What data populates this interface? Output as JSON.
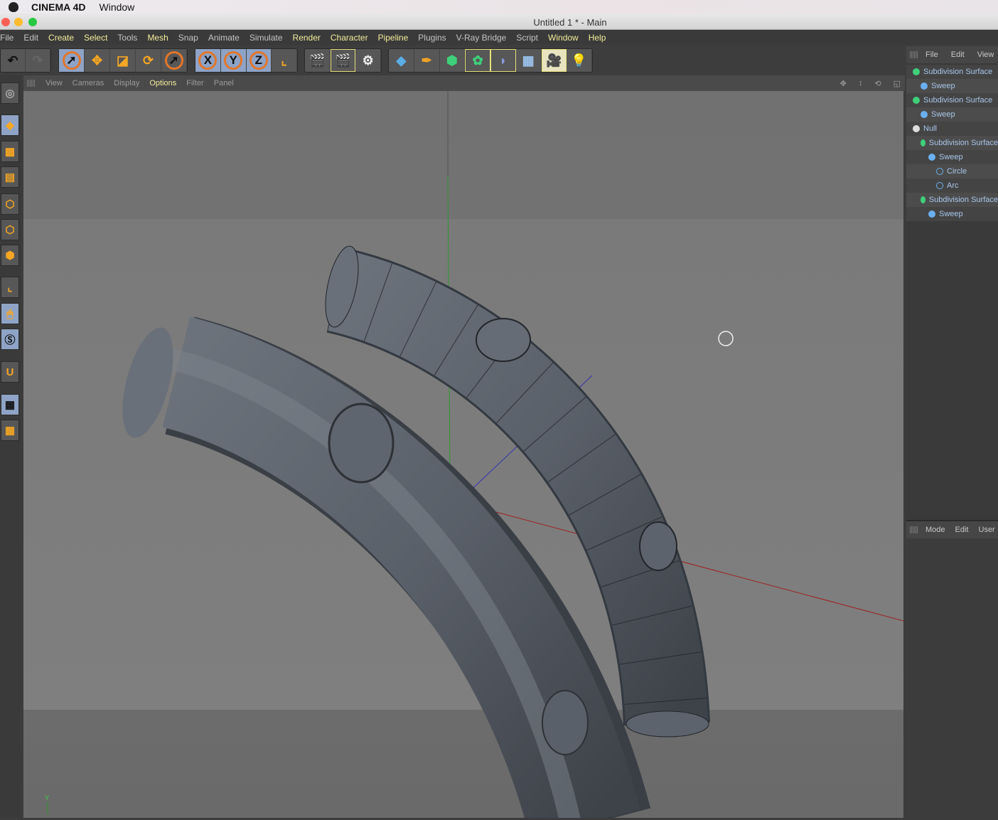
{
  "mac_menu": {
    "app": "CINEMA 4D",
    "items": [
      "Window"
    ]
  },
  "window": {
    "title": "Untitled 1 * - Main"
  },
  "menu": [
    {
      "label": "File",
      "hl": false
    },
    {
      "label": "Edit",
      "hl": false
    },
    {
      "label": "Create",
      "hl": true
    },
    {
      "label": "Select",
      "hl": true
    },
    {
      "label": "Tools",
      "hl": false
    },
    {
      "label": "Mesh",
      "hl": true
    },
    {
      "label": "Snap",
      "hl": false
    },
    {
      "label": "Animate",
      "hl": false
    },
    {
      "label": "Simulate",
      "hl": false
    },
    {
      "label": "Render",
      "hl": true
    },
    {
      "label": "Character",
      "hl": true
    },
    {
      "label": "Pipeline",
      "hl": true
    },
    {
      "label": "Plugins",
      "hl": false
    },
    {
      "label": "V-Ray Bridge",
      "hl": false
    },
    {
      "label": "Script",
      "hl": false
    },
    {
      "label": "Window",
      "hl": true
    },
    {
      "label": "Help",
      "hl": true
    }
  ],
  "toolbar": {
    "axis_x": "X",
    "axis_y": "Y",
    "axis_z": "Z"
  },
  "viewport": {
    "menu": [
      "View",
      "Cameras",
      "Display",
      "Options",
      "Filter",
      "Panel"
    ],
    "active": "Options",
    "axis_label": "Y"
  },
  "object_manager": {
    "menu": [
      "File",
      "Edit",
      "View"
    ],
    "items": [
      {
        "label": "Subdivision Surface",
        "indent": 0,
        "icon": "subdivision-icon"
      },
      {
        "label": "Sweep",
        "indent": 1,
        "icon": "sweep-icon"
      },
      {
        "label": "Subdivision Surface",
        "indent": 0,
        "icon": "subdivision-icon"
      },
      {
        "label": "Sweep",
        "indent": 1,
        "icon": "sweep-icon"
      },
      {
        "label": "Null",
        "indent": 0,
        "icon": "null-icon"
      },
      {
        "label": "Subdivision Surface",
        "indent": 1,
        "icon": "subdivision-icon"
      },
      {
        "label": "Sweep",
        "indent": 2,
        "icon": "sweep-icon"
      },
      {
        "label": "Circle",
        "indent": 3,
        "icon": "circle-spline-icon"
      },
      {
        "label": "Arc",
        "indent": 3,
        "icon": "arc-spline-icon"
      },
      {
        "label": "Subdivision Surface",
        "indent": 1,
        "icon": "subdivision-icon"
      },
      {
        "label": "Sweep",
        "indent": 2,
        "icon": "sweep-icon"
      }
    ]
  },
  "attribute_manager": {
    "menu": [
      "Mode",
      "Edit",
      "User"
    ]
  }
}
